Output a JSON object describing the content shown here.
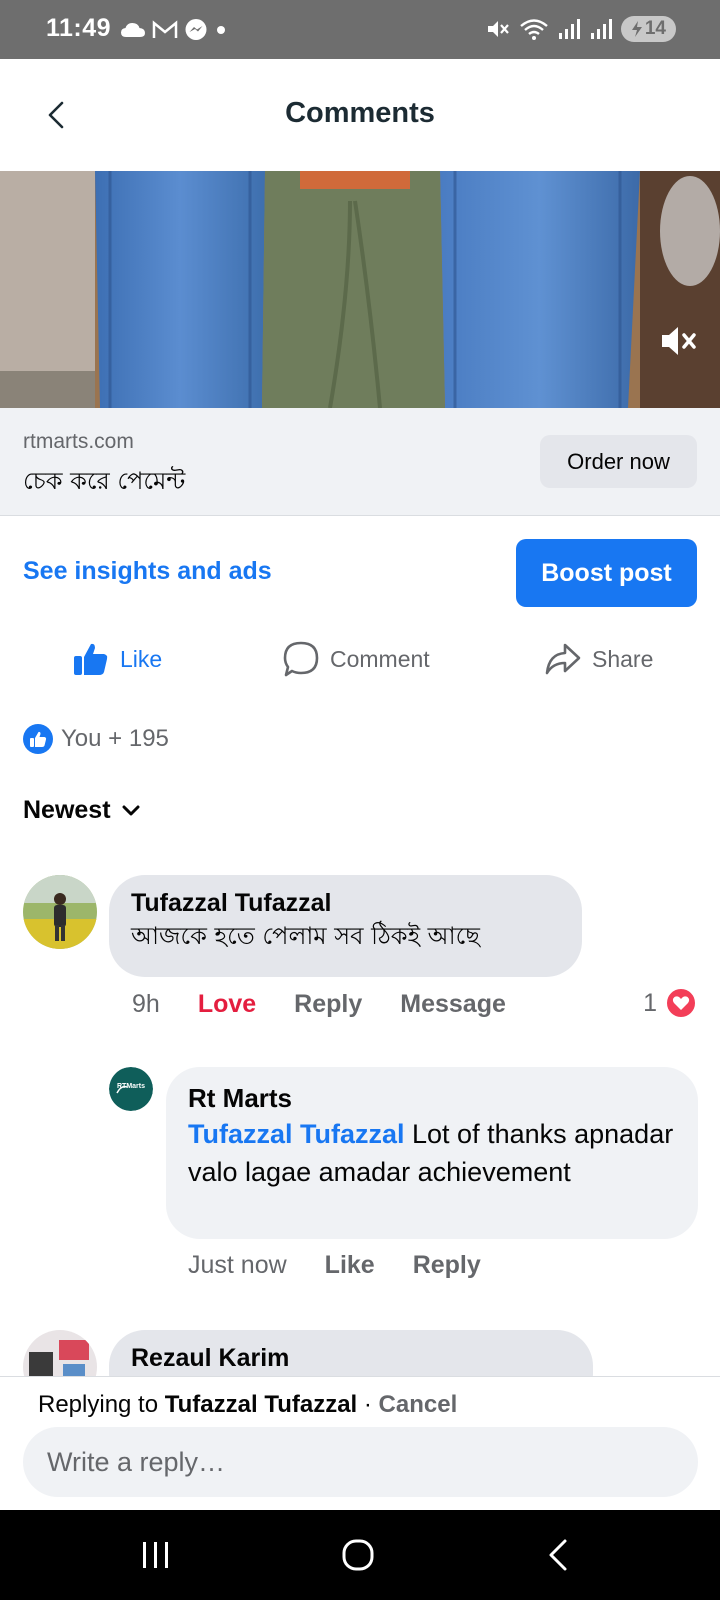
{
  "status_bar": {
    "time": "11:49",
    "battery": "14",
    "left_icons": [
      "cloud-icon",
      "gmail-icon",
      "messenger-icon",
      "dot-icon"
    ],
    "right_icons": [
      "mute-icon",
      "wifi-icon",
      "signal-icon",
      "signal-icon",
      "battery-icon"
    ]
  },
  "header": {
    "title": "Comments"
  },
  "link_preview": {
    "domain": "rtmarts.com",
    "title": "চেক করে পেমেন্ট",
    "cta": "Order now"
  },
  "insights": {
    "link_label": "See insights and ads",
    "boost_label": "Boost post"
  },
  "actions": {
    "like": "Like",
    "comment": "Comment",
    "share": "Share"
  },
  "reactions": {
    "summary": "You + 195"
  },
  "sort": {
    "label": "Newest"
  },
  "comments": [
    {
      "author": "Tufazzal Tufazzal",
      "text": "আজকে হতে পেলাম সব ঠিকই আছে",
      "time": "9h",
      "love_label": "Love",
      "reply_label": "Reply",
      "message_label": "Message",
      "reaction_count": "1"
    }
  ],
  "reply": {
    "author": "Rt Marts",
    "avatar_text": "RTMarts",
    "mention": "Tufazzal Tufazzal",
    "text": " Lot of thanks apnadar valo lagae amadar achievement",
    "time": "Just now",
    "like_label": "Like",
    "reply_label": "Reply"
  },
  "next_comment": {
    "author": "Rezaul Karim"
  },
  "composer": {
    "replying_prefix": "Replying to ",
    "replying_name": "Tufazzal Tufazzal",
    "separator": " · ",
    "cancel_label": "Cancel",
    "placeholder": "Write a reply…"
  },
  "colors": {
    "accent": "#1877f2",
    "love": "#e41e3f",
    "bubble": "#e4e6eb"
  }
}
